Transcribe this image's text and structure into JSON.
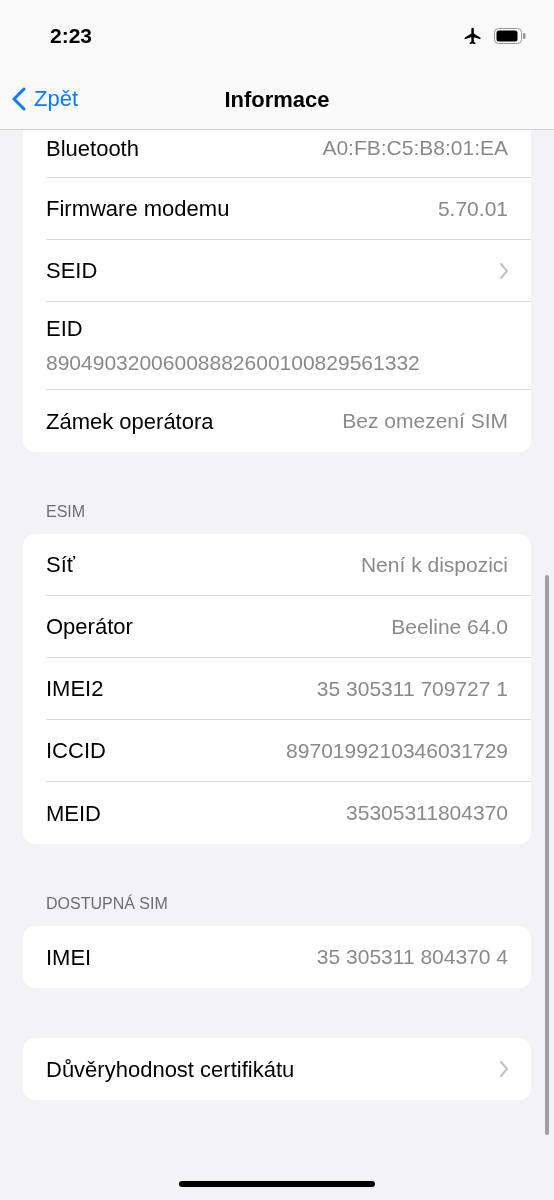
{
  "status_bar": {
    "time": "2:23"
  },
  "nav": {
    "back_label": "Zpět",
    "title": "Informace"
  },
  "sections": [
    {
      "cut_top": true,
      "rows": [
        {
          "kind": "value",
          "label": "Bluetooth",
          "value": "A0:FB:C5:B8:01:EA"
        },
        {
          "kind": "value",
          "label": "Firmware modemu",
          "value": "5.70.01"
        },
        {
          "kind": "chevron",
          "label": "SEID"
        },
        {
          "kind": "stacked",
          "label": "EID",
          "value": "89049032006008882600100829561332"
        },
        {
          "kind": "value",
          "label": "Zámek operátora",
          "value": "Bez omezení SIM"
        }
      ]
    },
    {
      "header": "ESIM",
      "rows": [
        {
          "kind": "value",
          "label": "Síť",
          "value": "Není k dispozici"
        },
        {
          "kind": "value",
          "label": "Operátor",
          "value": "Beeline 64.0"
        },
        {
          "kind": "value",
          "label": "IMEI2",
          "value": "35 305311 709727 1"
        },
        {
          "kind": "value",
          "label": "ICCID",
          "value": "8970199210346031729"
        },
        {
          "kind": "value",
          "label": "MEID",
          "value": "35305311804370"
        }
      ]
    },
    {
      "header": "DOSTUPNÁ SIM",
      "rows": [
        {
          "kind": "value",
          "label": "IMEI",
          "value": "35 305311 804370 4"
        }
      ]
    },
    {
      "rows": [
        {
          "kind": "chevron",
          "label": "Důvěryhodnost certifikátu"
        }
      ]
    }
  ]
}
